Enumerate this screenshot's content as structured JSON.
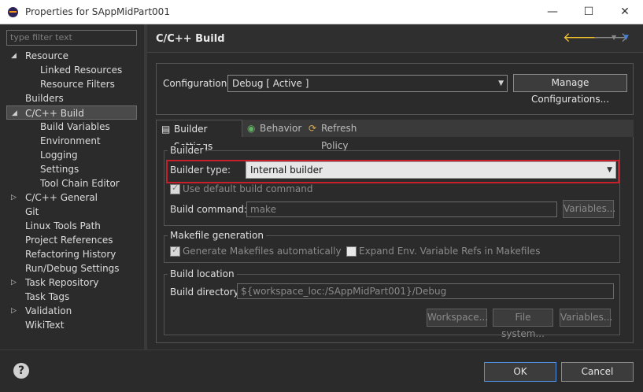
{
  "window": {
    "title": "Properties for SAppMidPart001",
    "minimize": "—",
    "maximize": "☐",
    "close": "✕"
  },
  "sidebar": {
    "filter_placeholder": "type filter text",
    "items": [
      {
        "label": "Resource",
        "twisty": "◢"
      },
      {
        "label": "Linked Resources",
        "twisty": ""
      },
      {
        "label": "Resource Filters",
        "twisty": ""
      },
      {
        "label": "Builders",
        "twisty": ""
      },
      {
        "label": "C/C++ Build",
        "twisty": "◢"
      },
      {
        "label": "Build Variables",
        "twisty": ""
      },
      {
        "label": "Environment",
        "twisty": ""
      },
      {
        "label": "Logging",
        "twisty": ""
      },
      {
        "label": "Settings",
        "twisty": ""
      },
      {
        "label": "Tool Chain Editor",
        "twisty": ""
      },
      {
        "label": "C/C++ General",
        "twisty": "▷"
      },
      {
        "label": "Git",
        "twisty": ""
      },
      {
        "label": "Linux Tools Path",
        "twisty": ""
      },
      {
        "label": "Project References",
        "twisty": ""
      },
      {
        "label": "Refactoring History",
        "twisty": ""
      },
      {
        "label": "Run/Debug Settings",
        "twisty": ""
      },
      {
        "label": "Task Repository",
        "twisty": "▷"
      },
      {
        "label": "Task Tags",
        "twisty": ""
      },
      {
        "label": "Validation",
        "twisty": "▷"
      },
      {
        "label": "WikiText",
        "twisty": ""
      }
    ]
  },
  "page": {
    "title": "C/C++ Build",
    "nav_back": "🡐",
    "nav_forward": "🡒",
    "nav_dropdown": "▼",
    "nav_menu": "▼"
  },
  "configuration": {
    "label": "Configuration:",
    "value": "Debug  [ Active ]",
    "manage_button": "Manage Configurations..."
  },
  "tabs": [
    {
      "label": "Builder Settings",
      "icon": "▤"
    },
    {
      "label": "Behavior",
      "icon": "◉"
    },
    {
      "label": "Refresh Policy",
      "icon": "⟳"
    }
  ],
  "builder": {
    "group_title": "Builder",
    "type_label": "Builder type:",
    "type_value": "Internal builder",
    "use_default_label": "Use default build command",
    "command_label": "Build command:",
    "command_value": "make",
    "variables_button": "Variables..."
  },
  "makefile": {
    "group_title": "Makefile generation",
    "generate_label": "Generate Makefiles automatically",
    "expand_label": "Expand Env. Variable Refs in Makefiles"
  },
  "build_location": {
    "group_title": "Build location",
    "directory_label": "Build directory:",
    "directory_value": "${workspace_loc:/SAppMidPart001}/Debug",
    "workspace_button": "Workspace...",
    "filesystem_button": "File system...",
    "variables_button": "Variables..."
  },
  "footer": {
    "help": "?",
    "ok_button": "OK",
    "cancel_button": "Cancel"
  }
}
